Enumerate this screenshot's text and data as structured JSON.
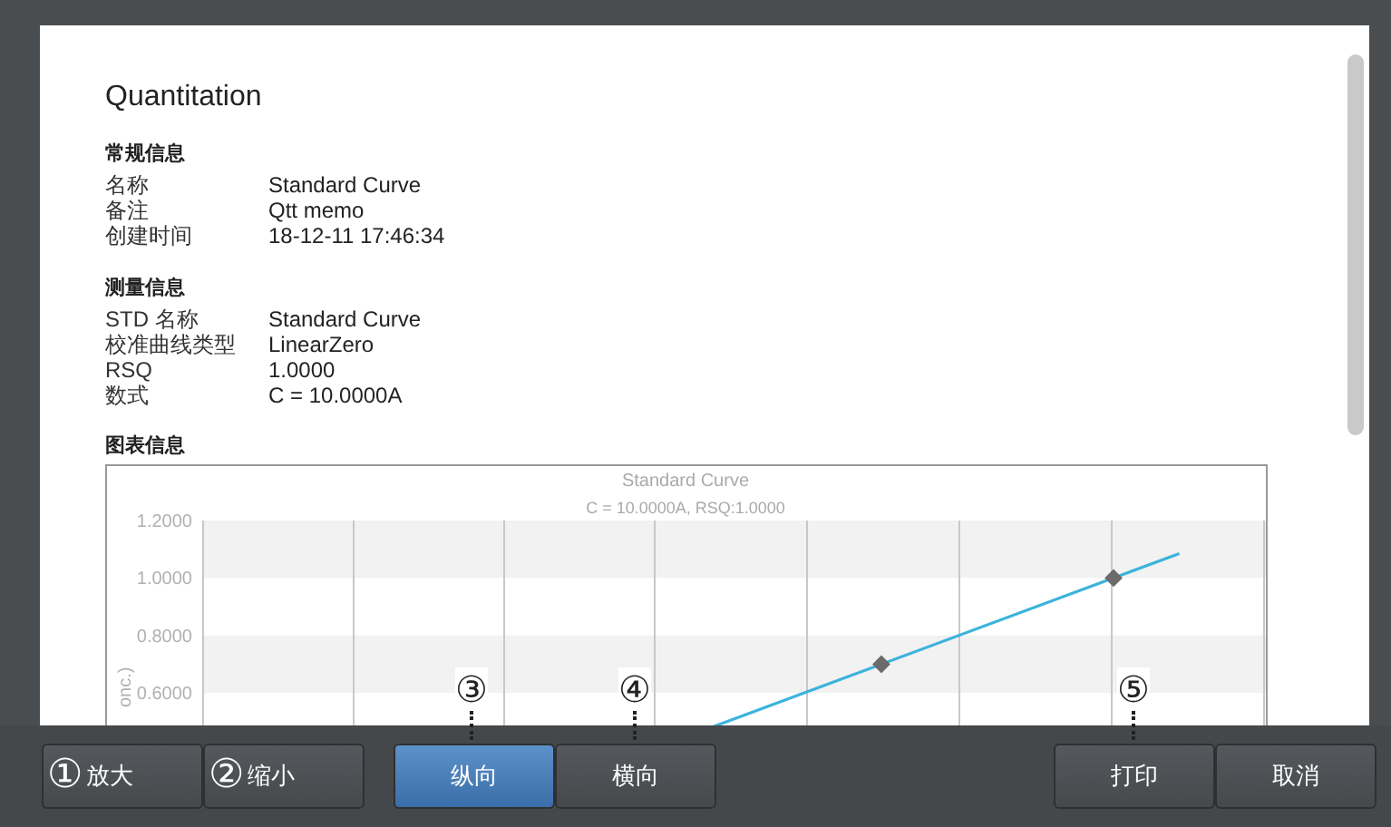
{
  "document": {
    "title": "Quantitation",
    "sections": [
      {
        "heading": "常规信息",
        "rows": [
          {
            "label": "名称",
            "value": "Standard Curve"
          },
          {
            "label": "备注",
            "value": "Qtt memo"
          },
          {
            "label": "创建时间",
            "value": "18-12-11 17:46:34"
          }
        ]
      },
      {
        "heading": "测量信息",
        "rows": [
          {
            "label": "STD 名称",
            "value": "Standard Curve"
          },
          {
            "label": "校准曲线类型",
            "value": "LinearZero"
          },
          {
            "label": "RSQ",
            "value": "1.0000"
          },
          {
            "label": "数式",
            "value": "C = 10.0000A"
          }
        ]
      }
    ],
    "chart_heading": "图表信息",
    "chart": {
      "title": "Standard Curve",
      "subtitle": "C = 10.0000A, RSQ:1.0000",
      "y_axis_label": "onc.)",
      "y_tick_labels": [
        "1.2000",
        "1.0000",
        "0.8000",
        "0.6000"
      ]
    }
  },
  "toolbar": {
    "groups": [
      {
        "buttons": [
          {
            "callout": "①",
            "label": "放大"
          },
          {
            "callout": "②",
            "label": "缩小"
          }
        ]
      },
      {
        "buttons": [
          {
            "label": "纵向",
            "selected": true
          },
          {
            "label": "横向",
            "selected": false
          }
        ]
      },
      {
        "buttons": [
          {
            "label": "打印"
          },
          {
            "label": "取消"
          }
        ]
      }
    ]
  },
  "callouts": [
    {
      "label": "③"
    },
    {
      "label": "④"
    },
    {
      "label": "⑤"
    }
  ]
}
